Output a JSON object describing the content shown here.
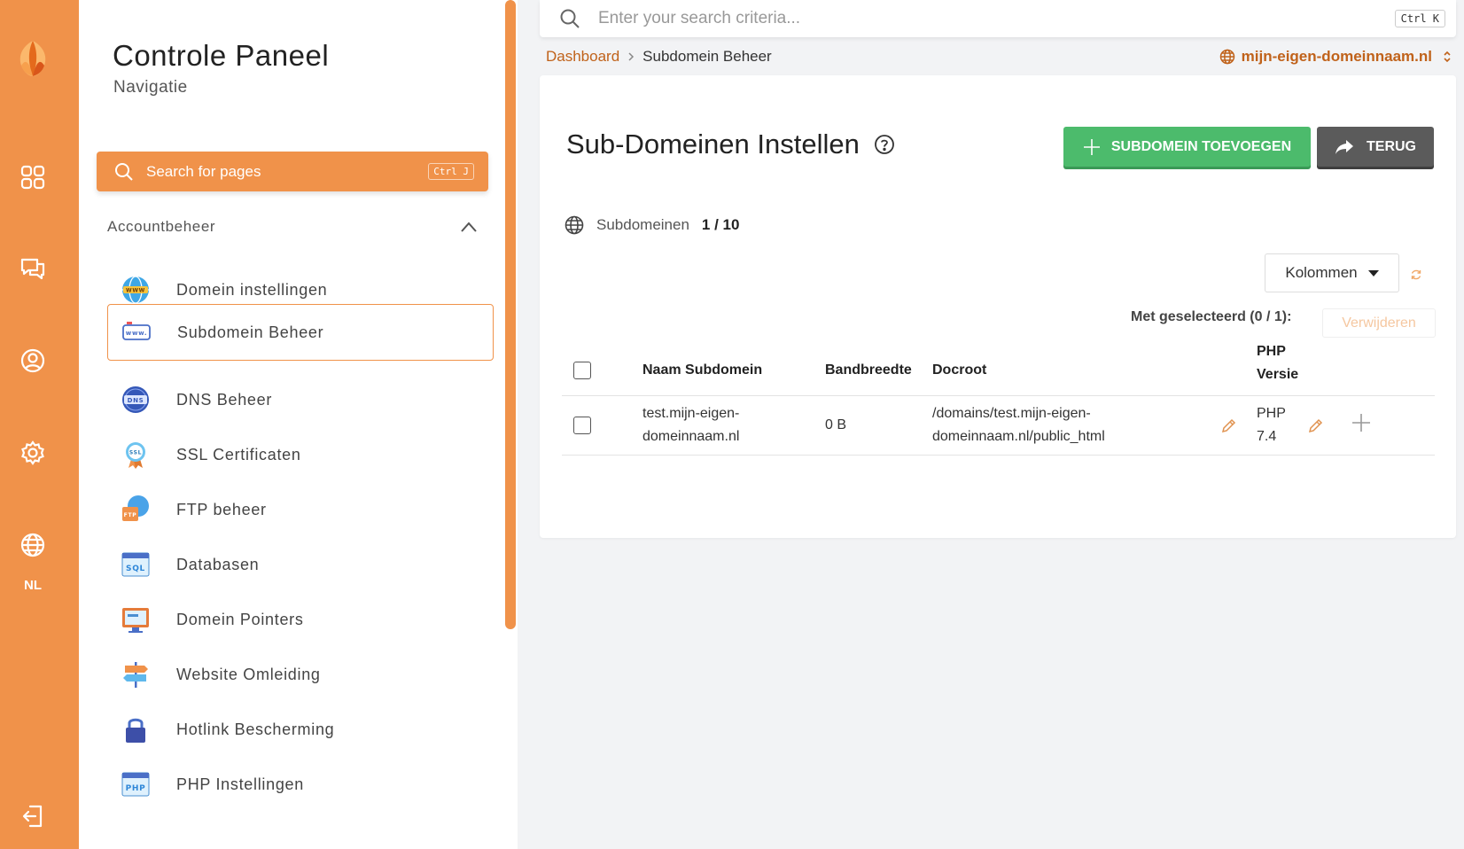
{
  "rail": {
    "language": "NL",
    "icons": [
      "dashboard-icon",
      "chat-icon",
      "user-icon",
      "settings-icon",
      "globe-icon",
      "logout-icon"
    ]
  },
  "nav": {
    "title": "Controle Paneel",
    "subtitle": "Navigatie",
    "search_placeholder": "Search for pages",
    "search_shortcut": "Ctrl J",
    "section_label": "Accountbeheer",
    "items": [
      {
        "label": "Domein instellingen",
        "icon": "www-globe-icon"
      },
      {
        "label": "Subdomein Beheer",
        "icon": "subdomain-icon",
        "active": true
      },
      {
        "label": "DNS Beheer",
        "icon": "dns-icon"
      },
      {
        "label": "SSL Certificaten",
        "icon": "ssl-badge-icon"
      },
      {
        "label": "FTP beheer",
        "icon": "ftp-icon"
      },
      {
        "label": "Databasen",
        "icon": "sql-icon"
      },
      {
        "label": "Domein Pointers",
        "icon": "monitor-icon"
      },
      {
        "label": "Website Omleiding",
        "icon": "signpost-icon"
      },
      {
        "label": "Hotlink Bescherming",
        "icon": "lock-icon"
      },
      {
        "label": "PHP Instellingen",
        "icon": "php-icon"
      }
    ]
  },
  "topbar": {
    "search_placeholder": "Enter your search criteria...",
    "search_shortcut": "Ctrl K"
  },
  "breadcrumb": {
    "home": "Dashboard",
    "current": "Subdomein Beheer"
  },
  "domain_selector": "mijn-eigen-domeinnaam.nl",
  "main": {
    "title": "Sub-Domeinen Instellen",
    "add_button": "SUBDOMEIN TOEVOEGEN",
    "back_button": "TERUG",
    "count_label": "Subdomeinen",
    "count_value": "1 / 10",
    "columns_button": "Kolommen",
    "selected_label": "Met geselecteerd (0 / 1):",
    "delete_button": "Verwijderen",
    "table": {
      "headers": {
        "name": "Naam Subdomein",
        "bandwidth": "Bandbreedte",
        "docroot": "Docroot",
        "php_line1": "PHP",
        "php_line2": "Versie"
      },
      "rows": [
        {
          "name_line1": "test.mijn-eigen-",
          "name_line2": "domeinnaam.nl",
          "bandwidth": "0 B",
          "docroot_line1": "/domains/test.mijn-eigen-",
          "docroot_line2": "domeinnaam.nl/public_html",
          "php_line1": "PHP",
          "php_line2": "7.4"
        }
      ]
    }
  },
  "colors": {
    "accent": "#f0924a",
    "link": "#c0621a",
    "success": "#4cbb6c",
    "dark_button": "#5b5b5b"
  }
}
